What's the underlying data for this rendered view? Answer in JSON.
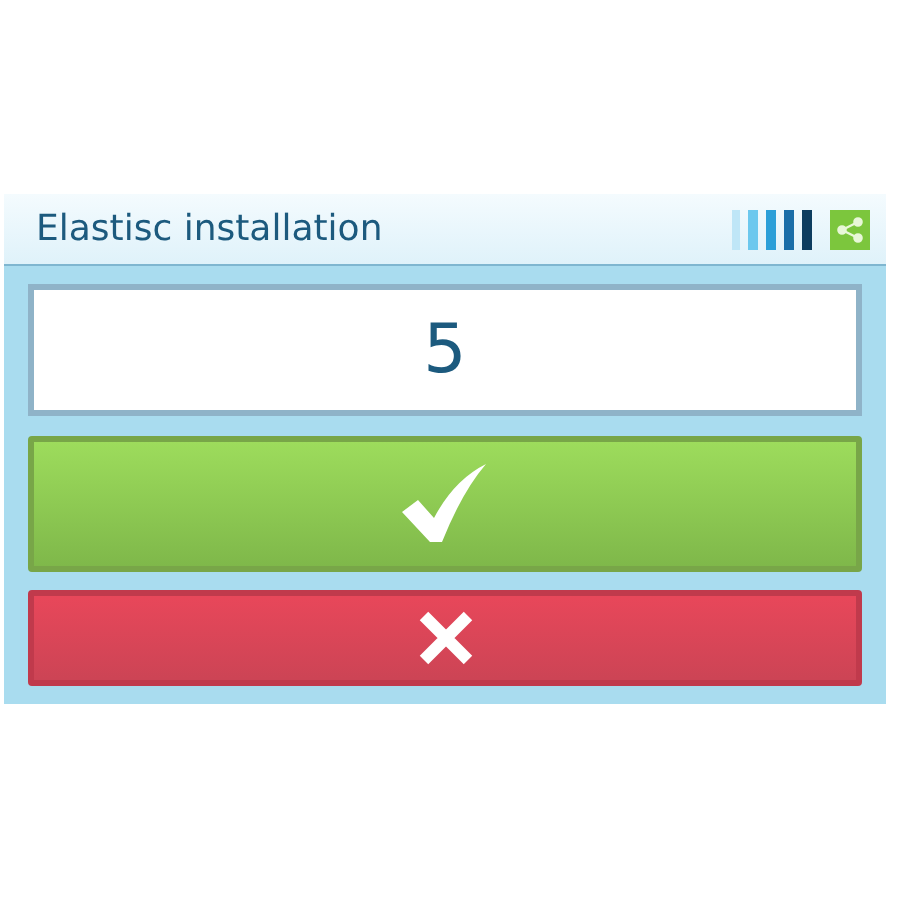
{
  "window": {
    "title": "Elastisc installation"
  },
  "value_field": {
    "value": "5"
  },
  "buttons": [
    {
      "kind": "confirm"
    },
    {
      "kind": "cancel"
    }
  ]
}
